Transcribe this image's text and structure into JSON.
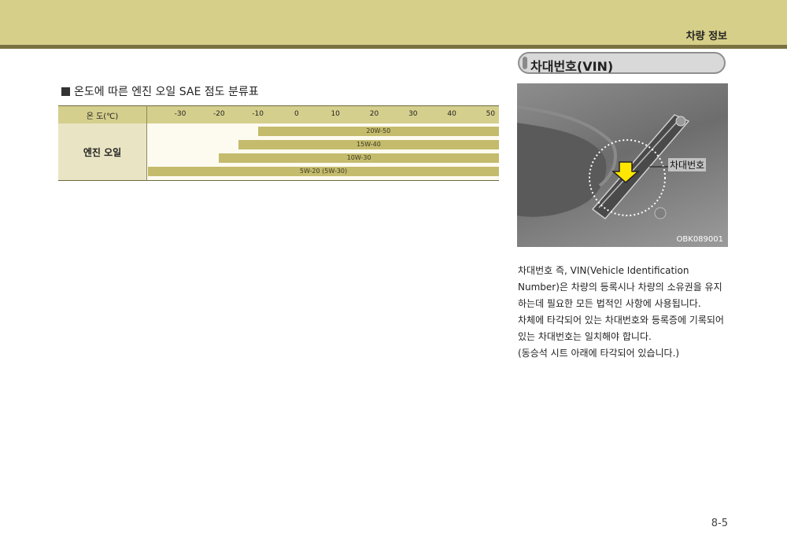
{
  "header": {
    "title": "차량 정보"
  },
  "left": {
    "table_title": "온도에 따른 엔진 오일 SAE 점도 분류표",
    "table": {
      "header_label": "온 도(℃)",
      "ticks": [
        "-30",
        "-20",
        "-10",
        "0",
        "10",
        "20",
        "30",
        "40",
        "50"
      ],
      "row_label": "엔진 오일",
      "bars": [
        {
          "label": "20W-50",
          "from": -10,
          "to": 50
        },
        {
          "label": "15W-40",
          "from": -15,
          "to": 50
        },
        {
          "label": "10W-30",
          "from": -20,
          "to": 50
        },
        {
          "label": "5W-20 (5W-30)",
          "from": -40,
          "to": 50
        }
      ]
    }
  },
  "right": {
    "section_title": "차대번호(VIN)",
    "image": {
      "callout": "차대번호",
      "code": "OBK089001"
    },
    "paragraphs": [
      "차대번호 즉, VIN(Vehicle Identification Number)은 차량의 등록시나 차량의 소유권을 유지하는데 필요한 모든 법적인 사항에 사용됩니다.",
      "차체에 타각되어 있는 차대번호와 등록증에 기록되어 있는 차대번호는 일치해야 합니다.",
      "(동승석 시트 아래에 타각되어 있습니다.)"
    ]
  },
  "footer": {
    "page_number": "8-5"
  }
}
